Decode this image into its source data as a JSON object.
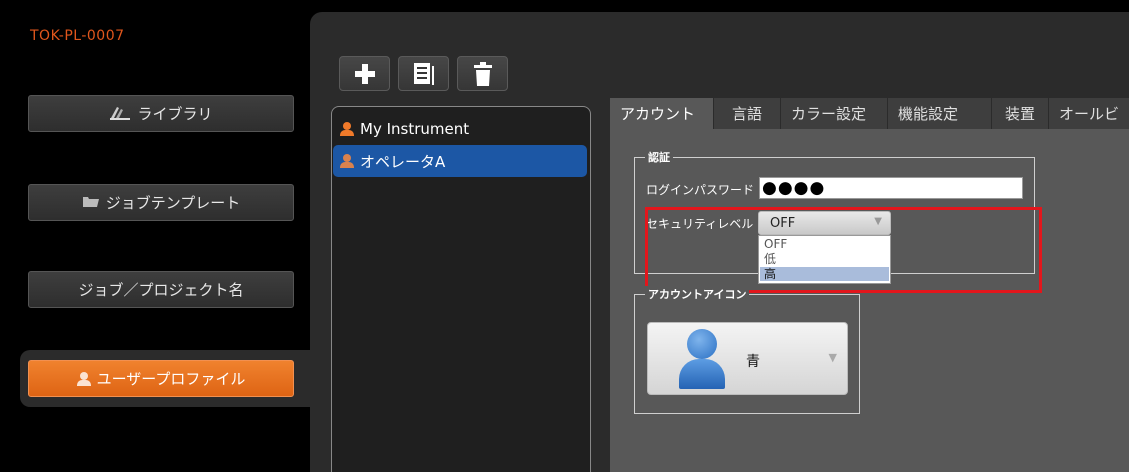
{
  "device_id": "TOK-PL-0007",
  "sidebar": {
    "items": [
      {
        "label": "ライブラリ",
        "icon": "library-icon"
      },
      {
        "label": "ジョブテンプレート",
        "icon": "folder-icon"
      },
      {
        "label": "ジョブ／プロジェクト名",
        "icon": ""
      },
      {
        "label": "ユーザープロファイル",
        "icon": "user-icon",
        "active": true
      }
    ]
  },
  "toolbar": {
    "buttons": [
      {
        "icon": "add-icon"
      },
      {
        "icon": "duplicate-icon"
      },
      {
        "icon": "trash-icon"
      }
    ]
  },
  "profiles": {
    "items": [
      {
        "label": "My Instrument",
        "icon": "user-icon"
      },
      {
        "label": "オペレータA",
        "icon": "user-icon",
        "selected": true
      }
    ]
  },
  "tabs": {
    "items": [
      {
        "label": "アカウント",
        "active": true
      },
      {
        "label": "言語"
      },
      {
        "label": "カラー設定"
      },
      {
        "label": "機能設定"
      },
      {
        "label": "装置"
      },
      {
        "label": "オールビ"
      }
    ]
  },
  "auth": {
    "group_label": "認証",
    "password_label": "ログインパスワード",
    "password_value": "●●●●",
    "security_label": "セキュリティレベル",
    "security_value": "OFF",
    "security_options": [
      "OFF",
      "低",
      "高"
    ],
    "security_highlighted": "高"
  },
  "account_icon": {
    "group_label": "アカウントアイコン",
    "value": "青",
    "icon": "person-avatar-icon"
  },
  "colors": {
    "accent": "#e0561c",
    "active_nav": "#f0822e",
    "selection": "#1c57a5",
    "highlight_box": "#e3161c"
  }
}
